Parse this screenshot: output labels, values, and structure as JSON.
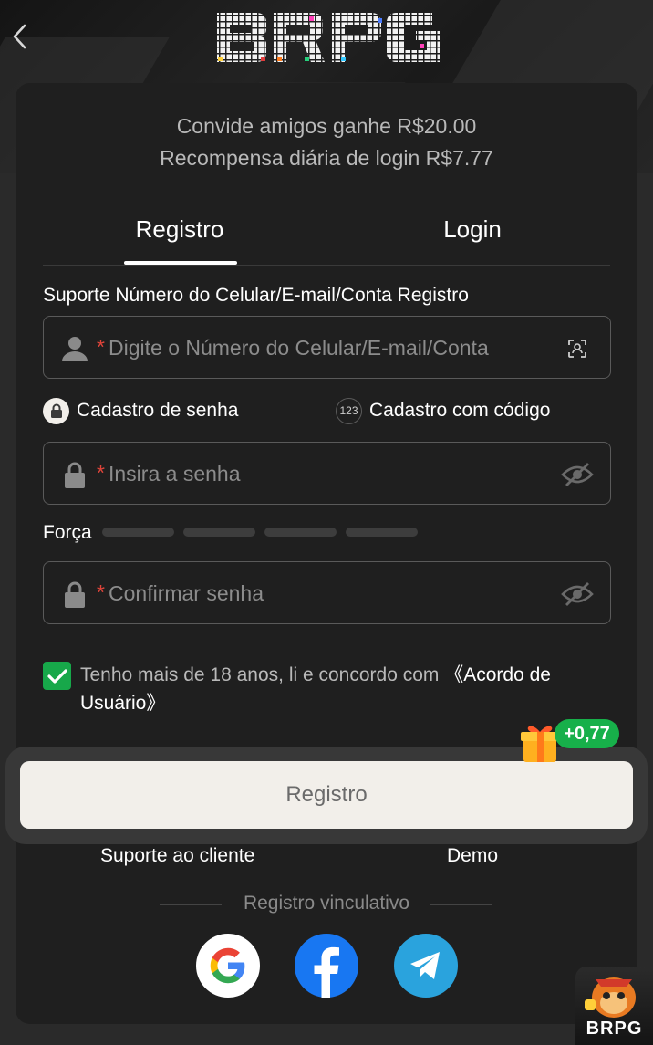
{
  "app": {
    "logo_text": "BRPG"
  },
  "promo": {
    "line1": "Convide amigos ganhe R$20.00",
    "line2": "Recompensa diária de login R$7.77"
  },
  "tabs": [
    {
      "label": "Registro",
      "active": true
    },
    {
      "label": "Login",
      "active": false
    }
  ],
  "account_field": {
    "label": "Suporte Número do Celular/E-mail/Conta Registro",
    "required_mark": "*",
    "placeholder": "Digite o Número do Celular/E-mail/Conta",
    "value": ""
  },
  "register_modes": [
    {
      "label": "Cadastro de senha",
      "icon": "lock-icon",
      "selected": true
    },
    {
      "label": "Cadastro com código",
      "icon": "123-icon",
      "badge": "123",
      "selected": false
    }
  ],
  "password_field": {
    "required_mark": "*",
    "placeholder": "Insira a senha",
    "value": ""
  },
  "strength": {
    "label": "Força",
    "level": 0,
    "segments": 4
  },
  "confirm_field": {
    "required_mark": "*",
    "placeholder": "Confirmar senha",
    "value": ""
  },
  "terms": {
    "checked": true,
    "text": "Tenho mais de 18 anos, li e concordo com",
    "link": "《Acordo de Usuário》"
  },
  "register_button": {
    "label": "Registro",
    "bonus": "+0,77"
  },
  "footer": {
    "support": "Suporte ao cliente",
    "demo": "Demo",
    "bind_label": "Registro vinculativo",
    "socials": [
      "google-icon",
      "facebook-icon",
      "telegram-icon"
    ]
  },
  "mascot": {
    "label": "BRPG"
  },
  "colors": {
    "accent_green": "#17a84a",
    "required_red": "#e0443a",
    "button_bg": "#f2efea",
    "card_bg": "#1f1f1f"
  }
}
